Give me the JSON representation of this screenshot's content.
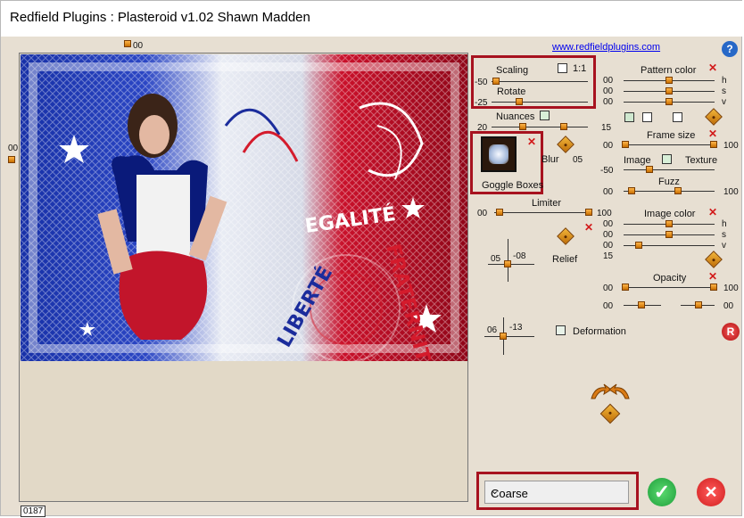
{
  "window": {
    "title": "Redfield Plugins : Plasteroid v1.02   Shawn Madden"
  },
  "top_link": "www.redfieldplugins.com",
  "help_icon": "?",
  "preview": {
    "top_value": "00",
    "left_value": "00",
    "bottom_value": "0187",
    "texts": [
      "LIBERTÉ",
      "EGALITÉ",
      "FRATERNITÉ"
    ]
  },
  "controls": {
    "scaling": {
      "label": "Scaling",
      "value": "-50"
    },
    "one_to_one": "1:1",
    "rotate": {
      "label": "Rotate",
      "value": "-25"
    },
    "nuances": {
      "label": "Nuances",
      "left": "20",
      "right": "15"
    },
    "goggle": {
      "label": "Goggle Boxes"
    },
    "blur": {
      "label": "Blur",
      "value": "05"
    },
    "limiter": {
      "label": "Limiter",
      "left": "00",
      "right": "100"
    },
    "relief": {
      "label": "Relief",
      "x": "05",
      "y": "-08"
    },
    "deformation": {
      "label": "Deformation",
      "x": "06",
      "y": "-13"
    }
  },
  "right_panel": {
    "pattern_color": {
      "label": "Pattern color",
      "values": [
        "00",
        "00",
        "00"
      ],
      "channels": [
        "h",
        "s",
        "v"
      ]
    },
    "frame_size": {
      "label": "Frame size",
      "left": "00",
      "right": "100"
    },
    "image": {
      "label": "Image",
      "value": "-50"
    },
    "texture": {
      "label": "Texture"
    },
    "fuzz": {
      "label": "Fuzz",
      "left": "00",
      "right": "100"
    },
    "image_color": {
      "label": "Image color",
      "values": [
        "00",
        "00",
        "00"
      ],
      "channels": [
        "h",
        "s",
        "v"
      ],
      "extra": "15"
    },
    "opacity": {
      "label": "Opacity",
      "left": "00",
      "right": "100",
      "second_left": "00",
      "second_right": "00"
    }
  },
  "reset_icon": "R",
  "quality": {
    "selected": "Coarse"
  },
  "buttons": {
    "ok_icon": "✓",
    "cancel_icon": "✕"
  },
  "colors": {
    "accent_red": "#a7121f",
    "ok_green": "#1f9f3b",
    "cancel_red": "#d11f1f"
  }
}
